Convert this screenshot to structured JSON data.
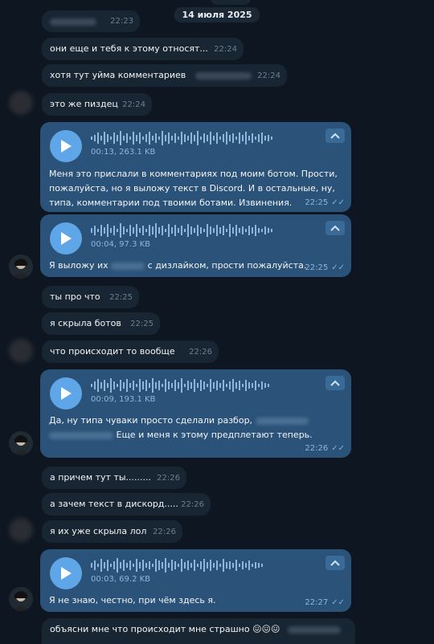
{
  "date_label": "14 июля 2025",
  "incoming": [
    {
      "text": "",
      "time": "22:23"
    },
    {
      "text": "они еще и тебя к этому относят...",
      "time": "22:24"
    },
    {
      "text": "хотя тут уйма комментариев",
      "time": "22:24"
    },
    {
      "text": "это же пиздец",
      "time": "22:24"
    },
    {
      "text": "ты про что",
      "time": "22:25"
    },
    {
      "text": "я скрыла ботов",
      "time": "22:25"
    },
    {
      "text": "что происходит то вообще",
      "time": "22:26"
    },
    {
      "text": "а причем тут ты.........",
      "time": "22:26"
    },
    {
      "text": "а зачем текст в дискорд.....",
      "time": "22:26"
    },
    {
      "text": "я их уже скрыла лол",
      "time": "22:26"
    },
    {
      "text": "объясни мне что происходит мне страшно 😖😖😖",
      "time": ""
    }
  ],
  "voice": [
    {
      "meta": "00:13, 263.1 KB",
      "text_lines": [
        "Меня это прислали в комментариях под моим ботом. Прости,",
        "пожалуйста, но я выложу текст в Discord. И в остальные, ну,",
        "типа, комментарии под твоими ботами. Извинения."
      ],
      "time": "22:25"
    },
    {
      "meta": "00:04, 97.3 KB",
      "text_a": "Я выложу их",
      "text_b": "с дизлайком, прости пожалуйста.",
      "time": "22:25"
    },
    {
      "meta": "00:09, 193.1 KB",
      "line1": "Да, ну типа чуваки просто сделали разбор,",
      "line2": "Еще и меня к этому предплетают теперь.",
      "time": "22:26"
    },
    {
      "meta": "00:03, 69.2 KB",
      "text": "Я не знаю, честно, при чём здесь я.",
      "time": "22:27"
    }
  ],
  "icons": {
    "play": "play-icon",
    "chevron": "chevron-up-icon",
    "read": "double-check-icon"
  },
  "colors": {
    "background": "#0e1621",
    "incoming": "#182533",
    "outgoing": "#2b5278",
    "play": "#5ea6e8"
  }
}
